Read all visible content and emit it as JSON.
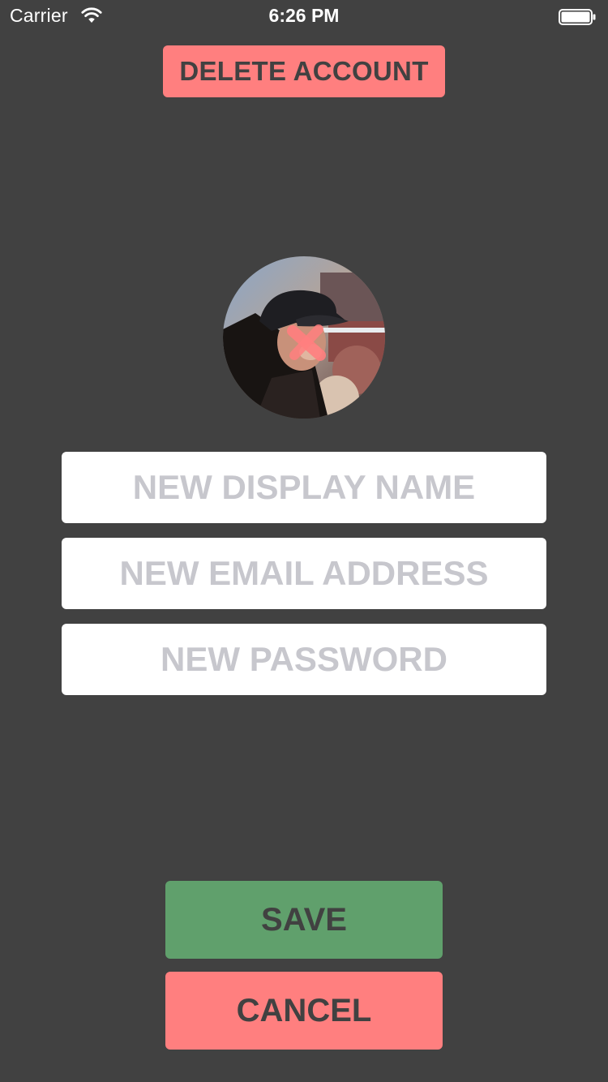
{
  "status_bar": {
    "carrier": "Carrier",
    "time": "6:26 PM",
    "wifi_icon": "wifi-icon",
    "battery_icon": "battery-icon"
  },
  "header": {
    "delete_account_label": "DELETE ACCOUNT"
  },
  "profile": {
    "avatar": "avatar-photo"
  },
  "form": {
    "display_name_placeholder": "NEW DISPLAY NAME",
    "email_placeholder": "NEW EMAIL ADDRESS",
    "password_placeholder": "NEW PASSWORD",
    "display_name_value": "",
    "email_value": "",
    "password_value": ""
  },
  "actions": {
    "save_label": "SAVE",
    "cancel_label": "CANCEL"
  },
  "colors": {
    "background": "#414141",
    "danger": "#ff7f7f",
    "success": "#60a06c",
    "placeholder": "#c7c7cd",
    "field": "#ffffff"
  }
}
